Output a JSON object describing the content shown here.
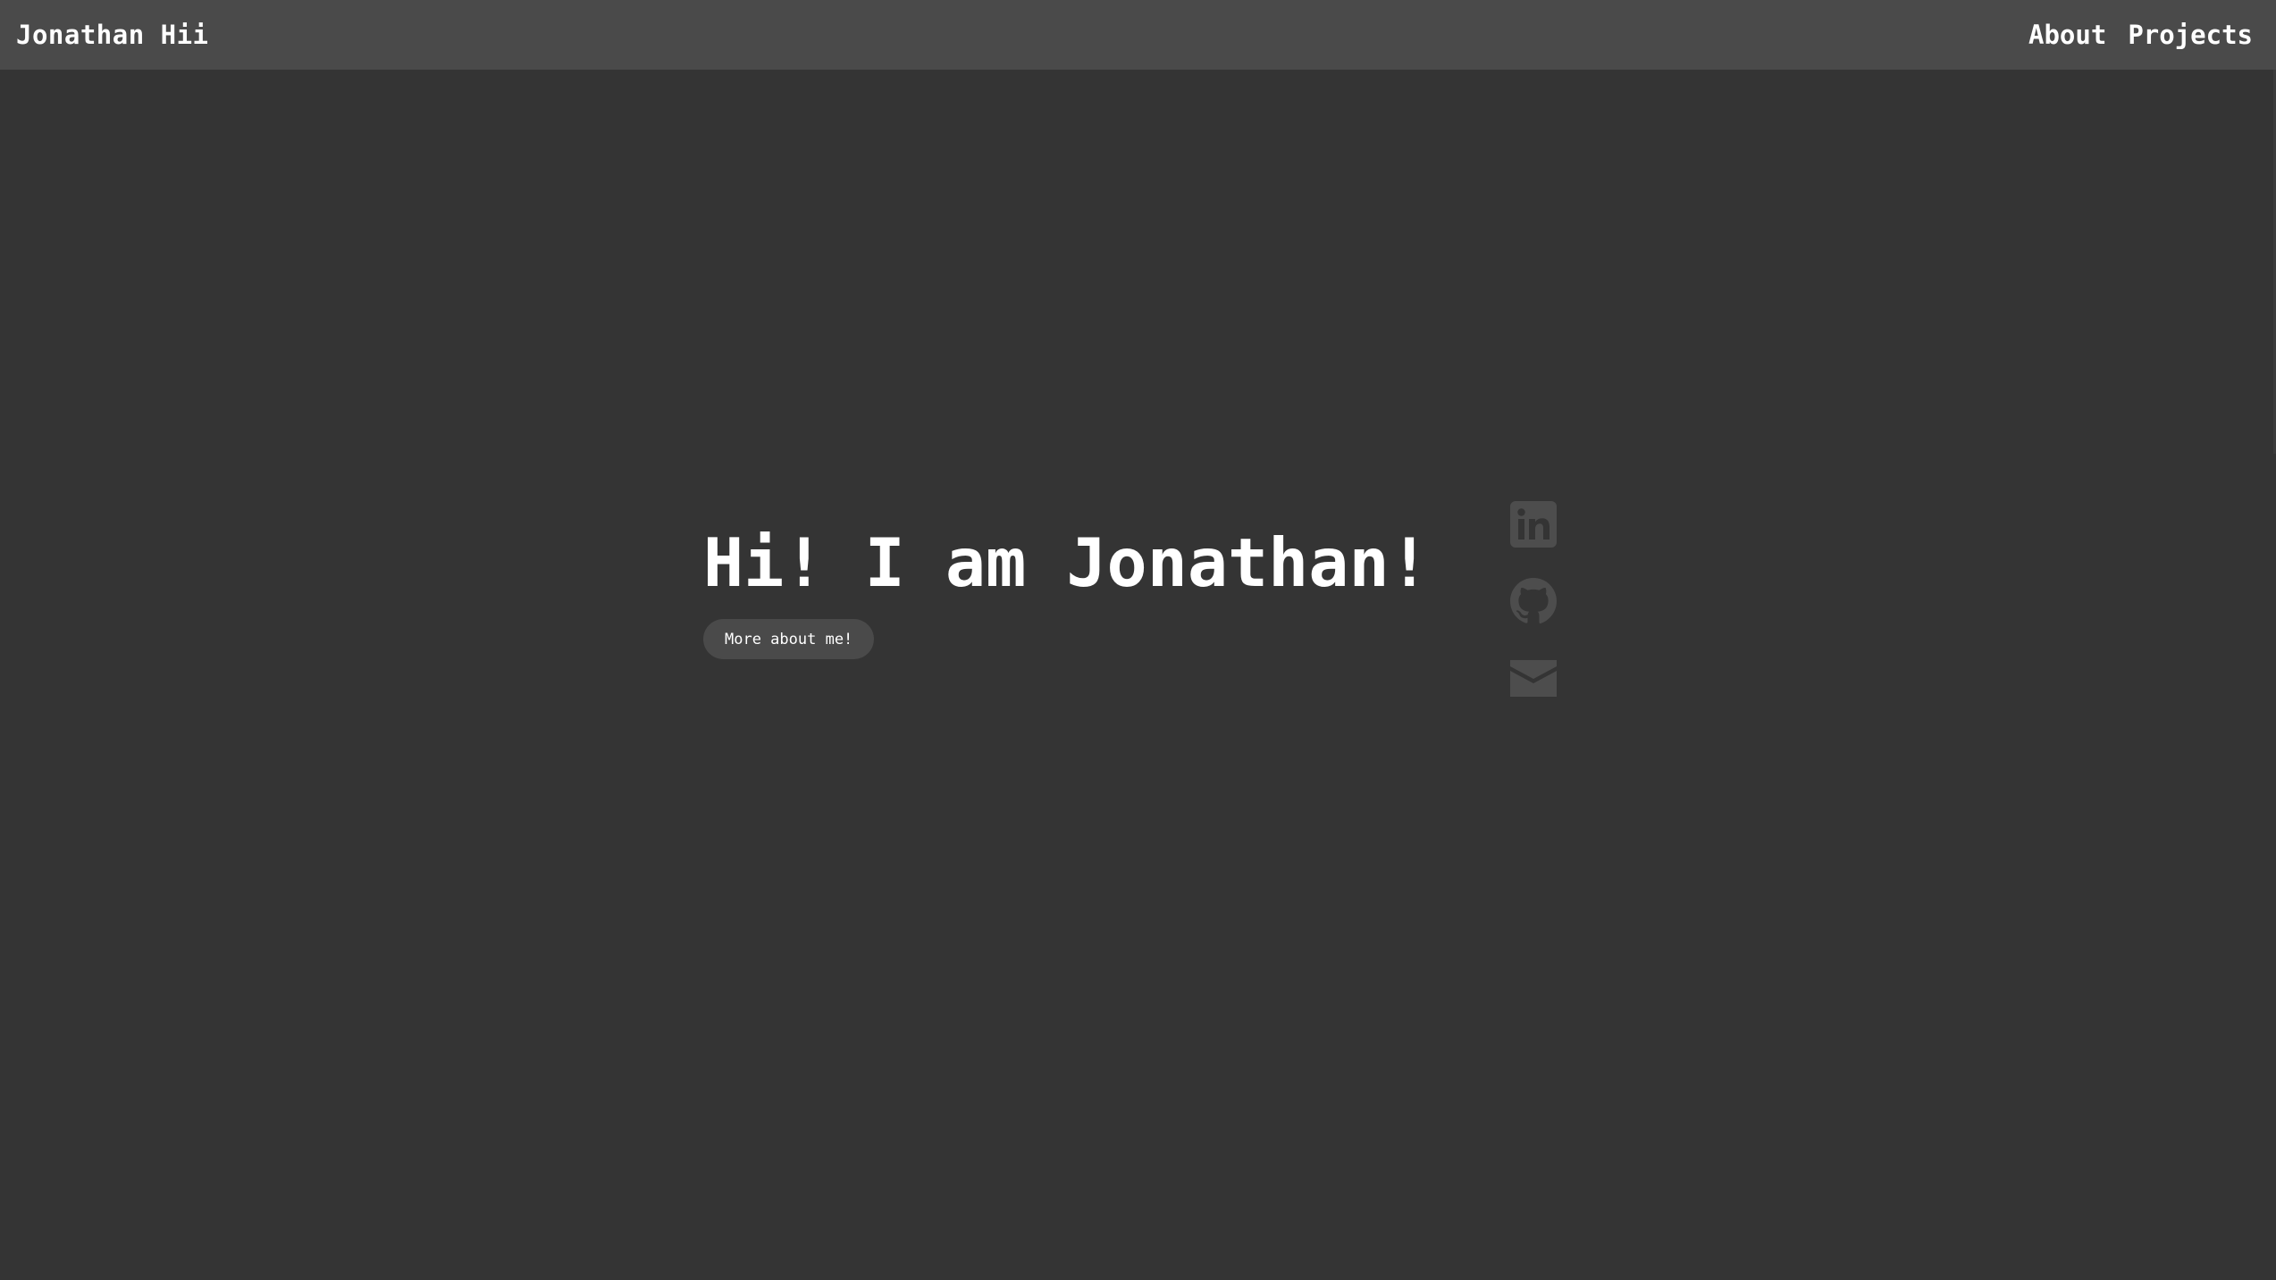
{
  "navbar": {
    "brand": "Jonathan Hii",
    "links": [
      {
        "label": "About"
      },
      {
        "label": "Projects"
      }
    ]
  },
  "hero": {
    "title": "Hi! I am Jonathan!",
    "button_label": "More about me!"
  },
  "social": [
    {
      "icon": "linkedin-icon"
    },
    {
      "icon": "github-icon"
    },
    {
      "icon": "mail-icon"
    }
  ],
  "colors": {
    "background": "#343434",
    "navbar": "#4a4a4a",
    "text": "#ffffff",
    "icon": "#4d4d4d"
  }
}
